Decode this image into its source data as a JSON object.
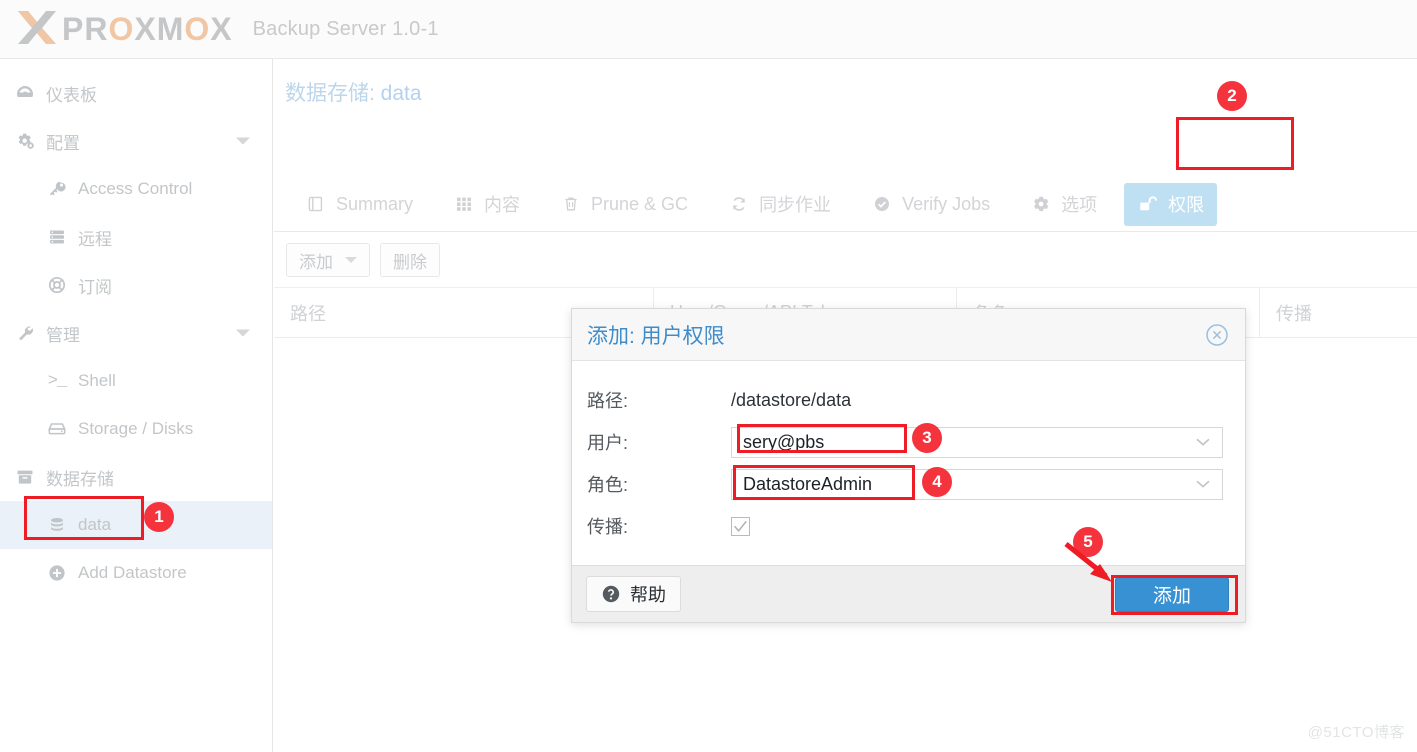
{
  "header": {
    "logo_text_1": "PR",
    "logo_text_o": "O",
    "logo_text_2": "XM",
    "logo_text_o2": "O",
    "logo_text_3": "X",
    "logo_full": "PROXMOX",
    "product_title": "Backup Server 1.0-1",
    "logo_icon": "proxmox-x-logo"
  },
  "sidebar": {
    "items": [
      {
        "label": "仪表板",
        "icon": "dashboard-icon",
        "level": "top",
        "caret": false,
        "selected": false
      },
      {
        "label": "配置",
        "icon": "gears-icon",
        "level": "top",
        "caret": true,
        "selected": false
      },
      {
        "label": "Access Control",
        "icon": "key-icon",
        "level": "child",
        "caret": false,
        "selected": false
      },
      {
        "label": "远程",
        "icon": "server-icon",
        "level": "child",
        "caret": false,
        "selected": false
      },
      {
        "label": "订阅",
        "icon": "lifebuoy-icon",
        "level": "child",
        "caret": false,
        "selected": false
      },
      {
        "label": "管理",
        "icon": "wrench-icon",
        "level": "top",
        "caret": true,
        "selected": false
      },
      {
        "label": "Shell",
        "icon": "terminal-icon",
        "level": "child",
        "caret": false,
        "selected": false
      },
      {
        "label": "Storage / Disks",
        "icon": "hdd-icon",
        "level": "child",
        "caret": false,
        "selected": false
      },
      {
        "label": "数据存储",
        "icon": "archive-icon",
        "level": "top",
        "caret": false,
        "selected": false
      },
      {
        "label": "data",
        "icon": "database-icon",
        "level": "child",
        "caret": false,
        "selected": true
      },
      {
        "label": "Add Datastore",
        "icon": "plus-circle-icon",
        "level": "child",
        "caret": false,
        "selected": false
      }
    ]
  },
  "main": {
    "page_title_prefix": "数据存储: ",
    "page_title_name": "data",
    "tabs": [
      {
        "label": "Summary",
        "icon": "book-icon",
        "active": false
      },
      {
        "label": "内容",
        "icon": "grid-icon",
        "active": false
      },
      {
        "label": "Prune & GC",
        "icon": "trash-icon",
        "active": false
      },
      {
        "label": "同步作业",
        "icon": "sync-icon",
        "active": false
      },
      {
        "label": "Verify Jobs",
        "icon": "check-circle-icon",
        "active": false
      },
      {
        "label": "选项",
        "icon": "gear-icon",
        "active": false
      },
      {
        "label": "权限",
        "icon": "unlock-icon",
        "active": true
      }
    ],
    "toolbar": {
      "add_label": "添加",
      "remove_label": "删除"
    },
    "grid": {
      "columns": [
        "路径",
        "User/Group/API Token",
        "角色",
        "传播"
      ],
      "rows": []
    }
  },
  "dialog": {
    "title": "添加: 用户权限",
    "close_icon": "close-circle-icon",
    "fields": {
      "path_label": "路径:",
      "path_value": "/datastore/data",
      "user_label": "用户:",
      "user_value": "sery@pbs",
      "role_label": "角色:",
      "role_value": "DatastoreAdmin",
      "propagate_label": "传播:",
      "propagate_checked": true
    },
    "footer": {
      "help_label": "帮助",
      "help_icon": "question-circle-icon",
      "submit_label": "添加"
    }
  },
  "annotations": {
    "badges": [
      {
        "id": "1",
        "target": "sidebar-item-data"
      },
      {
        "id": "2",
        "target": "tab-permissions"
      },
      {
        "id": "3",
        "target": "dialog-user-field"
      },
      {
        "id": "4",
        "target": "dialog-role-field"
      },
      {
        "id": "5",
        "target": "dialog-add-button"
      }
    ],
    "accent_color": "#ee1c25",
    "badge_color": "#f4333c"
  },
  "watermark": "@51CTO博客"
}
